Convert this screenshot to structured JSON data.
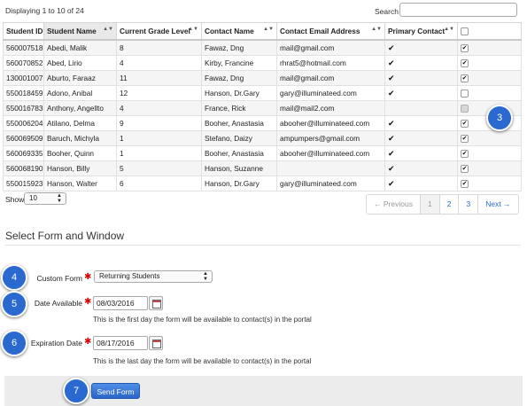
{
  "top": {
    "displaying": "Displaying 1 to 10 of 24",
    "search_label": "Search",
    "search_value": ""
  },
  "table": {
    "headers": [
      "Student ID",
      "Student Name",
      "Current Grade Level",
      "Contact Name",
      "Contact Email Address",
      "Primary Contact",
      ""
    ],
    "rows": [
      {
        "id": "560007518",
        "name": "Abedi, Malik",
        "grade": "8",
        "contact": "Fawaz, Dng",
        "email": "mail@gmail.com",
        "primary": true,
        "selected": true,
        "disabled": false
      },
      {
        "id": "560070852",
        "name": "Abed, Lirio",
        "grade": "4",
        "contact": "Kirby, Francine",
        "email": "rhrat5@hotmail.com",
        "primary": true,
        "selected": true,
        "disabled": false
      },
      {
        "id": "130001007",
        "name": "Aburto, Faraaz",
        "grade": "11",
        "contact": "Fawaz, Dng",
        "email": "mail@gmail.com",
        "primary": true,
        "selected": true,
        "disabled": false
      },
      {
        "id": "550018459",
        "name": "Adono, Anibal",
        "grade": "12",
        "contact": "Hanson, Dr.Gary",
        "email": "gary@illuminateed.com",
        "primary": true,
        "selected": false,
        "disabled": false
      },
      {
        "id": "550016783",
        "name": "Anthony, Angellto",
        "grade": "4",
        "contact": "France, Rick",
        "email": "mail@mail2.com",
        "primary": false,
        "selected": false,
        "disabled": true
      },
      {
        "id": "550006204",
        "name": "Atilano, Delma",
        "grade": "9",
        "contact": "Booher, Anastasia",
        "email": "abooher@illuminateed.com",
        "primary": true,
        "selected": true,
        "disabled": false
      },
      {
        "id": "560069509",
        "name": "Baruch, Michyla",
        "grade": "1",
        "contact": "Stefano, Daizy",
        "email": "ampumpers@gmail.com",
        "primary": true,
        "selected": true,
        "disabled": false
      },
      {
        "id": "560069335",
        "name": "Booher, Quinn",
        "grade": "1",
        "contact": "Booher, Anastasia",
        "email": "abooher@illuminateed.com",
        "primary": true,
        "selected": true,
        "disabled": false
      },
      {
        "id": "560068190",
        "name": "Hanson, Billy",
        "grade": "5",
        "contact": "Hanson, Suzanne",
        "email": "",
        "primary": true,
        "selected": true,
        "disabled": false
      },
      {
        "id": "550015923",
        "name": "Hanson, Walter",
        "grade": "6",
        "contact": "Hanson, Dr.Gary",
        "email": "gary@illuminateed.com",
        "primary": true,
        "selected": true,
        "disabled": false
      }
    ]
  },
  "show": {
    "label": "Show",
    "value": "10"
  },
  "pagination": {
    "prev": "← Previous",
    "pages": [
      "1",
      "2",
      "3"
    ],
    "current": "1",
    "next": "Next →"
  },
  "section": {
    "title": "Select Form and Window"
  },
  "form": {
    "custom_form_label": "Custom Form",
    "custom_form_value": "Returning Students",
    "date_available_label": "Date Available",
    "date_available_value": "08/03/2016",
    "date_available_help": "This is the first day the form will be available to contact(s) in the portal",
    "expiration_label": "Expiration Date",
    "expiration_value": "08/17/2016",
    "expiration_help": "This is the last day the form will be available to contact(s) in the portal",
    "send_label": "Send Form"
  },
  "callouts": [
    "3",
    "4",
    "5",
    "6",
    "7"
  ],
  "colors": {
    "accent": "#2a6ad0",
    "required": "#dd0000",
    "check": "#111111"
  }
}
